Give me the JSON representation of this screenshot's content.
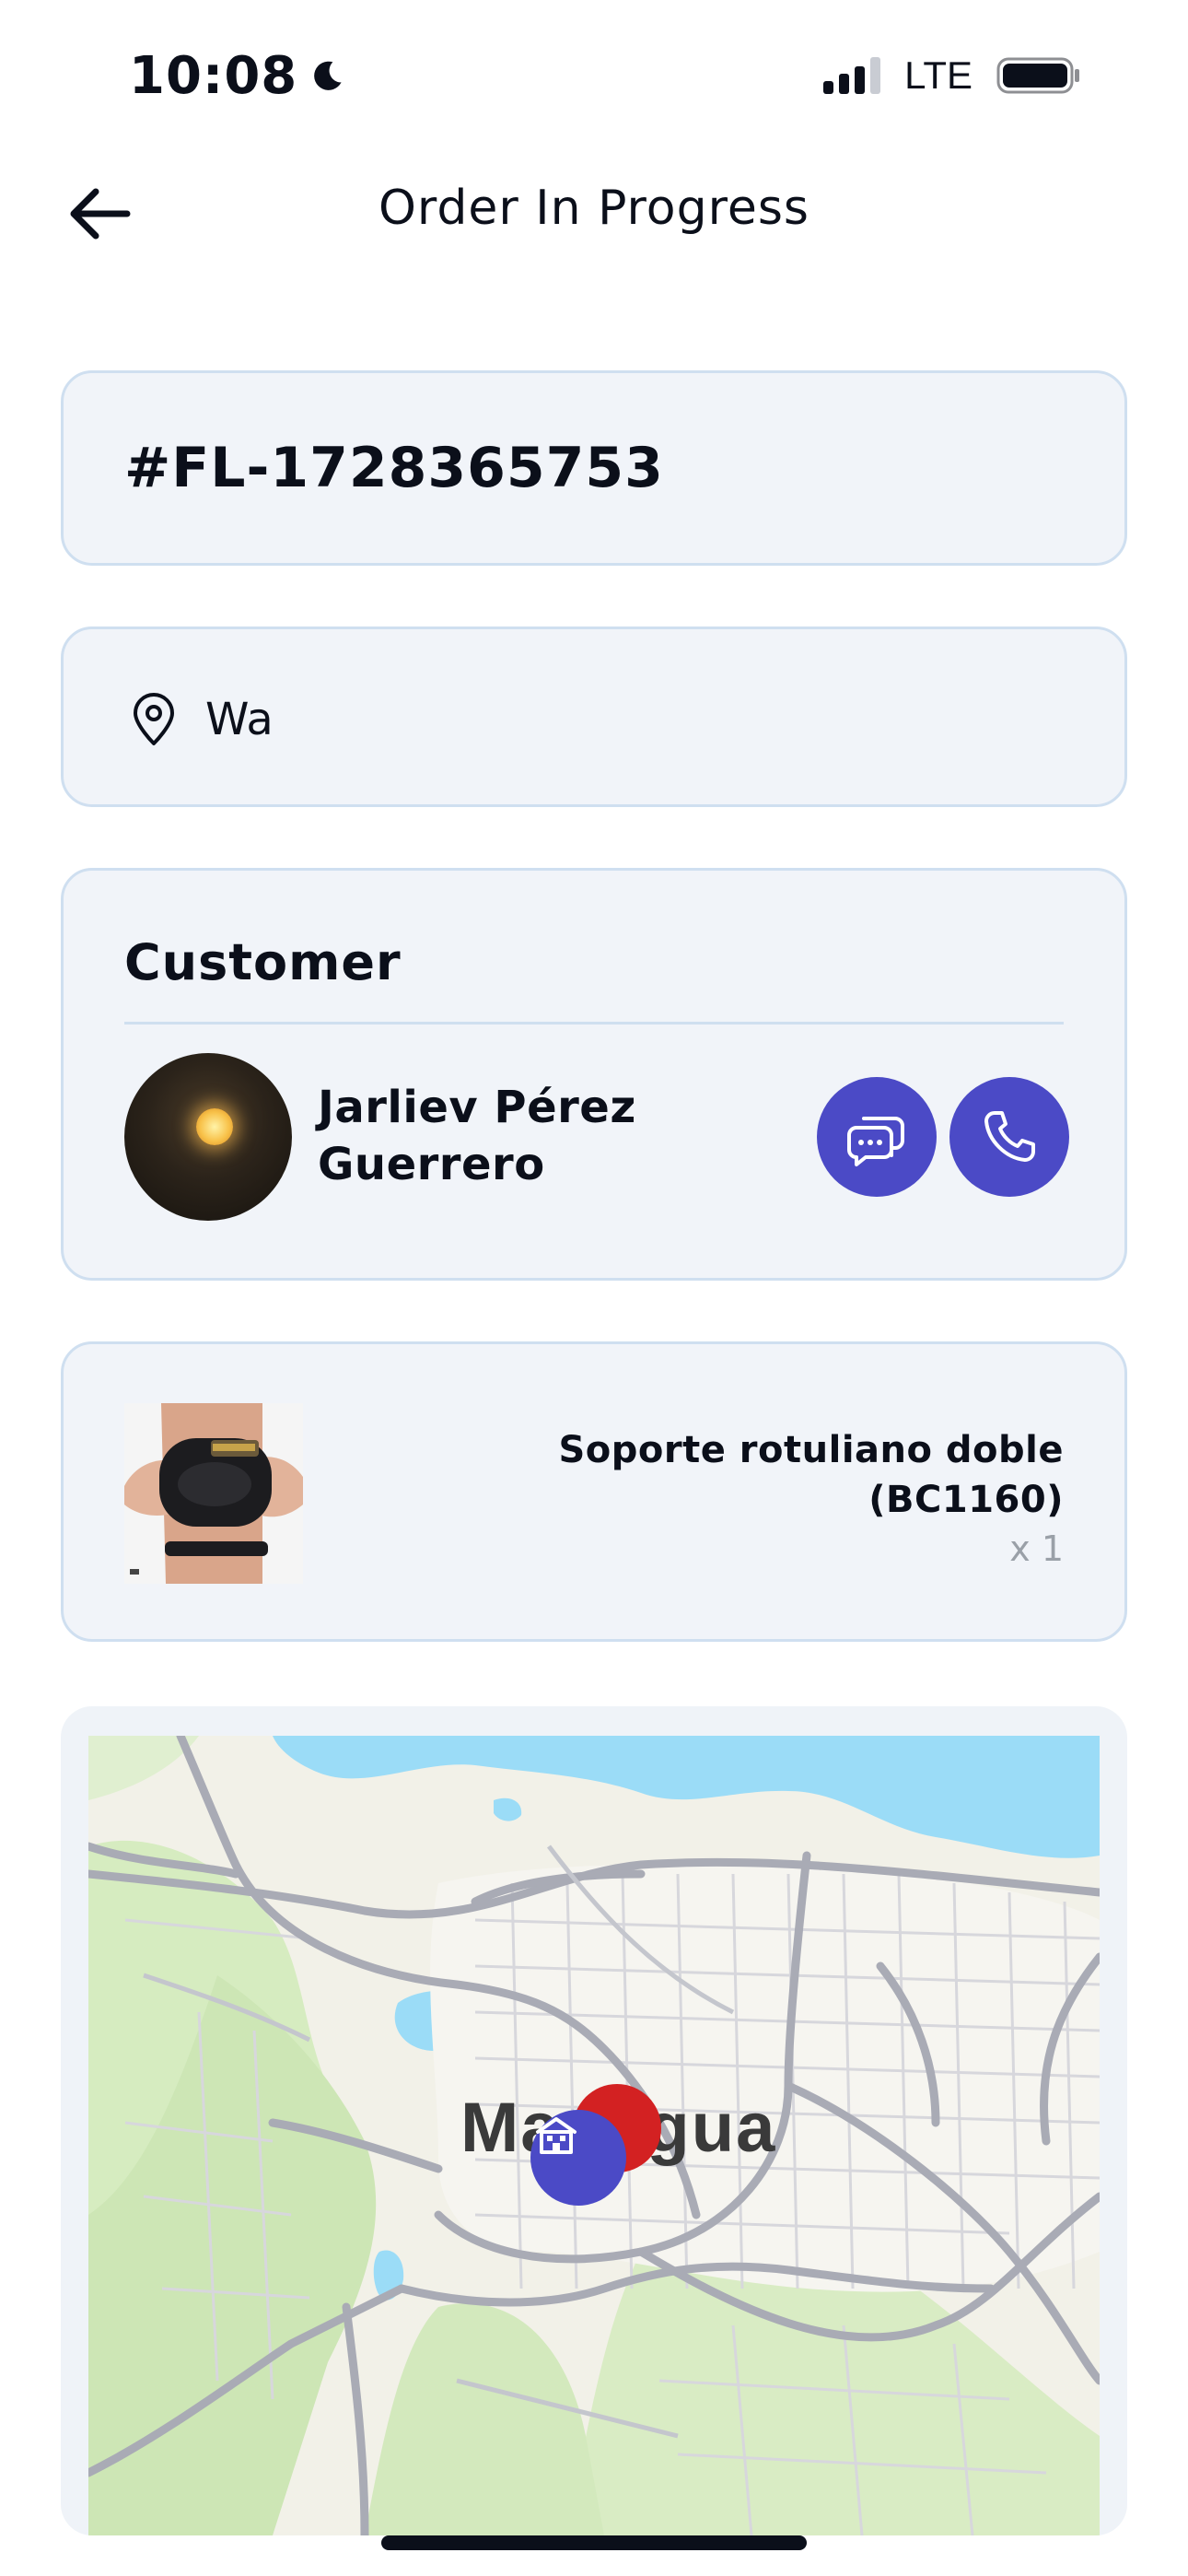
{
  "status_bar": {
    "time": "10:08",
    "network": "LTE",
    "icons": [
      "moon-icon",
      "signal-icon",
      "battery-icon"
    ]
  },
  "nav": {
    "title": "Order In Progress",
    "back_icon": "arrow-left-icon"
  },
  "order": {
    "id": "#FL-1728365753"
  },
  "address": {
    "icon": "location-pin-icon",
    "text": "Wa"
  },
  "customer": {
    "heading": "Customer",
    "name": "Jarliev Pérez Guerrero",
    "actions": [
      "chat-icon",
      "phone-icon"
    ]
  },
  "product": {
    "name": "Soporte  rotuliano doble (BC1160)",
    "quantity": "x 1"
  },
  "map": {
    "city_label": "Managua",
    "markers": [
      "destination-marker",
      "store-icon"
    ]
  },
  "colors": {
    "accent": "#4b4ac6",
    "card_bg": "#f1f4f9",
    "card_border": "#cfdff0",
    "marker_red": "#d32122",
    "water": "#9bdcf7"
  }
}
